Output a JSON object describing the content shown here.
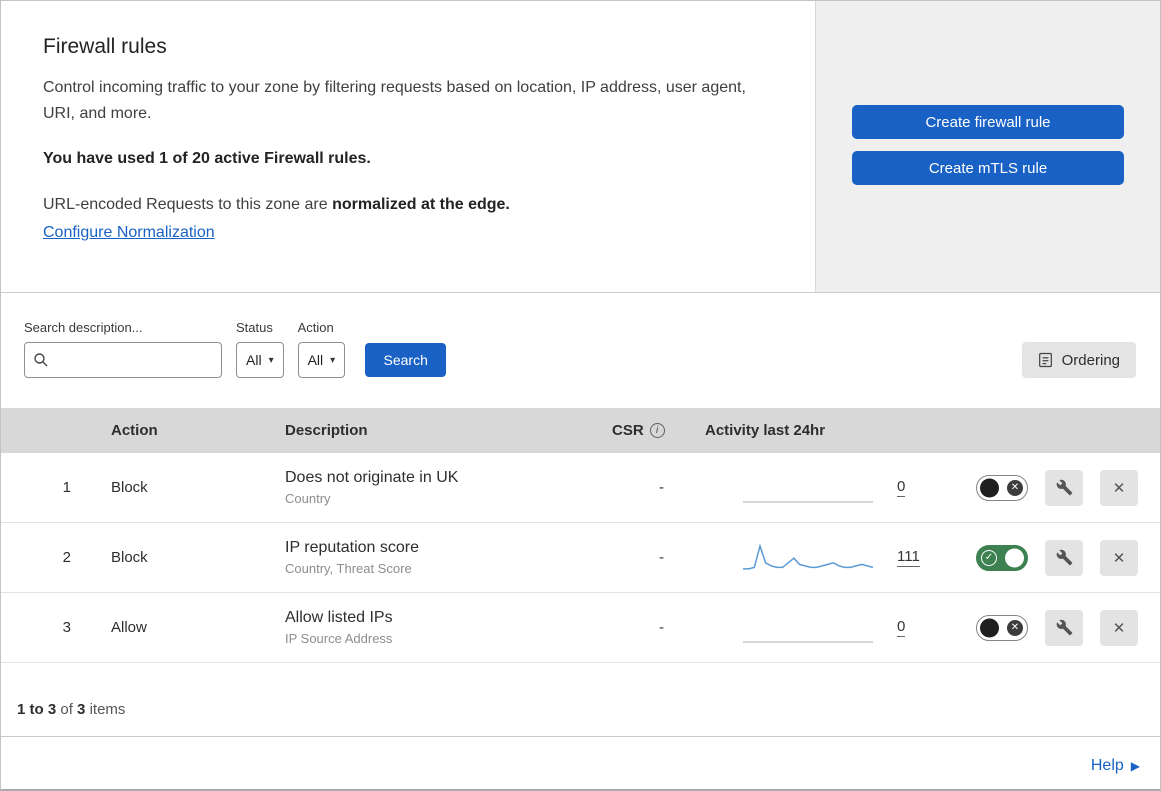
{
  "header": {
    "title": "Firewall rules",
    "description": "Control incoming traffic to your zone by filtering requests based on location, IP address, user agent, URI, and more.",
    "usage": "You have used 1 of 20 active Firewall rules.",
    "normalization": {
      "prefix": "URL-encoded Requests to this zone are ",
      "bold": "normalized at the edge.",
      "link": "Configure Normalization"
    },
    "actions": {
      "create_firewall_rule": "Create firewall rule",
      "create_mtls_rule": "Create mTLS rule"
    }
  },
  "filters": {
    "search": {
      "label": "Search description...",
      "value": ""
    },
    "status": {
      "label": "Status",
      "value": "All"
    },
    "action": {
      "label": "Action",
      "value": "All"
    },
    "search_button": "Search",
    "ordering_button": "Ordering"
  },
  "table": {
    "headers": {
      "action": "Action",
      "description": "Description",
      "csr": "CSR",
      "activity": "Activity last 24hr"
    },
    "rows": [
      {
        "priority": "1",
        "action": "Block",
        "description": "Does not originate in UK",
        "criteria": "Country",
        "csr": "-",
        "count": "0",
        "enabled": false,
        "sparkline": [
          0,
          0,
          0,
          0,
          0,
          0,
          0,
          0,
          0,
          0,
          0,
          0,
          0,
          0,
          0,
          0,
          0,
          0,
          0,
          0
        ]
      },
      {
        "priority": "2",
        "action": "Block",
        "description": "IP reputation score",
        "criteria": "Country, Threat Score",
        "csr": "-",
        "count": "111",
        "enabled": true,
        "sparkline": [
          2,
          2,
          3,
          17,
          6,
          4,
          3,
          3,
          6,
          9,
          5,
          4,
          3,
          3,
          4,
          5,
          6,
          4,
          3,
          3,
          4,
          5,
          4,
          3
        ]
      },
      {
        "priority": "3",
        "action": "Allow",
        "description": "Allow listed IPs",
        "criteria": "IP Source Address",
        "csr": "-",
        "count": "0",
        "enabled": false,
        "sparkline": [
          0,
          0,
          0,
          0,
          0,
          0,
          0,
          0,
          0,
          0,
          0,
          0,
          0,
          0,
          0,
          0,
          0,
          0,
          0,
          0
        ]
      }
    ],
    "footer": {
      "range": "1 to 3",
      "of_text": "of",
      "total": "3",
      "items_text": "items"
    }
  },
  "help": {
    "label": "Help"
  },
  "icons": {
    "caret_down": "▾",
    "close": "✕",
    "check": "✓",
    "cross": "✕",
    "help_arrow": "▶",
    "info": "i"
  },
  "colors": {
    "accent_blue": "#1961c5",
    "toggle_on_green": "#3d8150",
    "sparkline_active": "#5b9bd5",
    "sparkline_flat": "#c9c9c9"
  }
}
